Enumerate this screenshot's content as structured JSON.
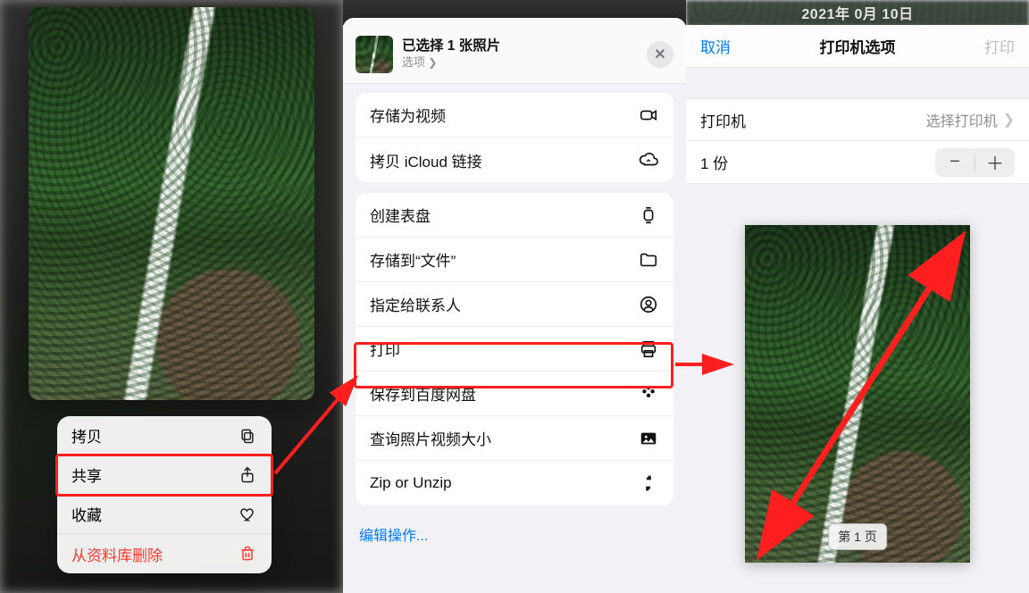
{
  "left": {
    "context_menu": [
      {
        "label": "拷贝",
        "icon": "copy-icon",
        "danger": false
      },
      {
        "label": "共享",
        "icon": "share-icon",
        "danger": false
      },
      {
        "label": "收藏",
        "icon": "heart-icon",
        "danger": false
      },
      {
        "label": "从资料库删除",
        "icon": "trash-icon",
        "danger": true
      }
    ]
  },
  "mid": {
    "header_title": "已选择 1 张照片",
    "header_subtitle": "选项",
    "groups": [
      [
        {
          "label": "存储为视频",
          "icon": "video-icon"
        },
        {
          "label": "拷贝 iCloud 链接",
          "icon": "cloud-link-icon"
        }
      ],
      [
        {
          "label": "创建表盘",
          "icon": "watch-icon"
        },
        {
          "label": "存储到“文件”",
          "icon": "folder-icon"
        },
        {
          "label": "指定给联系人",
          "icon": "contact-icon"
        },
        {
          "label": "打印",
          "icon": "print-icon"
        },
        {
          "label": "保存到百度网盘",
          "icon": "baidu-icon"
        },
        {
          "label": "查询照片视频大小",
          "icon": "image-size-icon"
        },
        {
          "label": "Zip or Unzip",
          "icon": "compress-icon"
        }
      ]
    ],
    "edit_actions": "编辑操作..."
  },
  "right": {
    "top_date_partial": "2021年 0月 10日",
    "cancel": "取消",
    "title": "打印机选项",
    "print": "打印",
    "printer_label": "打印机",
    "printer_value": "选择打印机",
    "copies_label": "1 份",
    "page_badge": "第 1 页"
  }
}
